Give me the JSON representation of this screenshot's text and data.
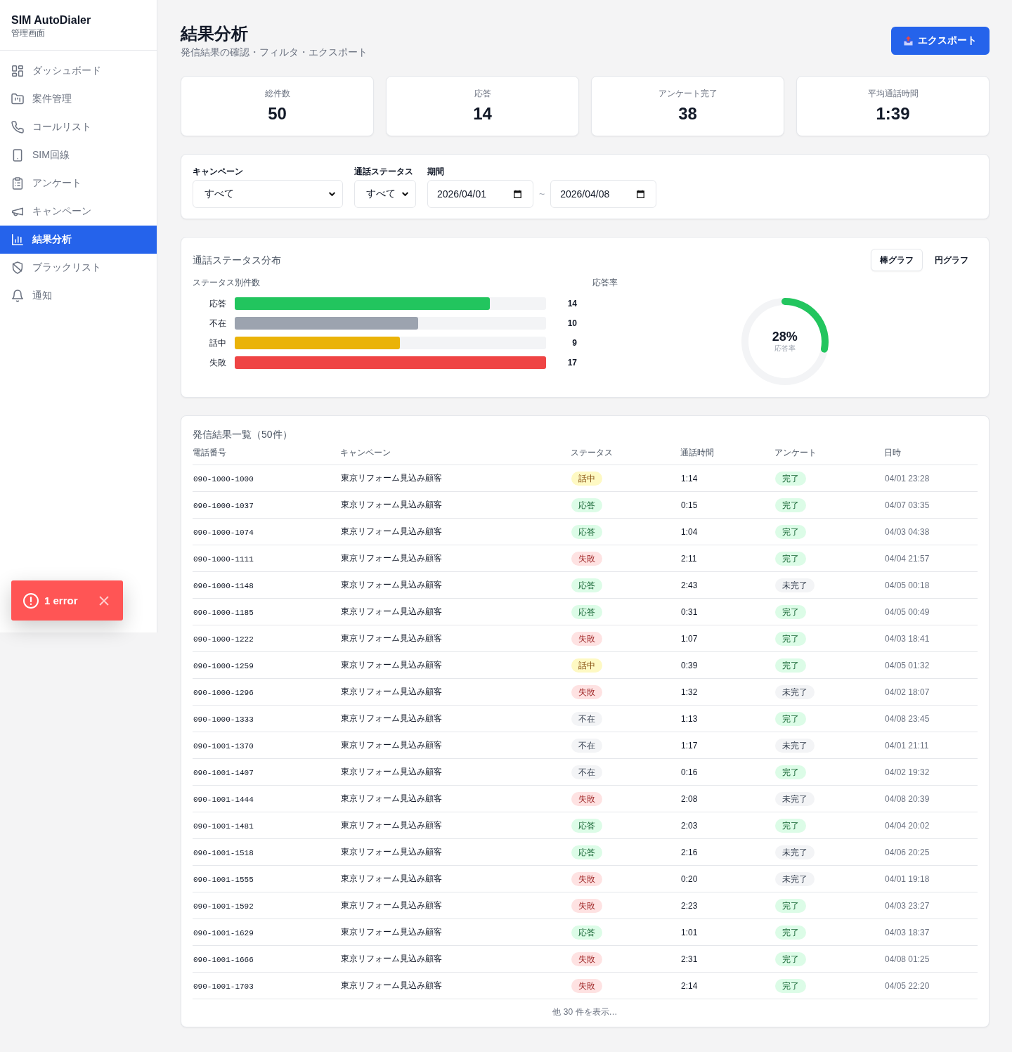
{
  "sidebar": {
    "brand": "SIM AutoDialer",
    "subtitle": "管理画面",
    "items": [
      {
        "label": "ダッシュボード",
        "selected": false
      },
      {
        "label": "案件管理",
        "selected": false
      },
      {
        "label": "コールリスト",
        "selected": false
      },
      {
        "label": "SIM回線",
        "selected": false
      },
      {
        "label": "アンケート",
        "selected": false
      },
      {
        "label": "キャンペーン",
        "selected": false
      },
      {
        "label": "結果分析",
        "selected": true
      },
      {
        "label": "ブラックリスト",
        "selected": false
      },
      {
        "label": "通知",
        "selected": false
      }
    ]
  },
  "header": {
    "title": "結果分析",
    "subtitle": "発信結果の確認・フィルタ・エクスポート",
    "export_button": "エクスポート"
  },
  "stats": [
    {
      "label": "総件数",
      "value": "50"
    },
    {
      "label": "応答",
      "value": "14"
    },
    {
      "label": "アンケート完了",
      "value": "38"
    },
    {
      "label": "平均通話時間",
      "value": "1:39"
    }
  ],
  "filters": {
    "campaign": {
      "label": "キャンペーン",
      "value": "すべて"
    },
    "status": {
      "label": "通話ステータス",
      "value": "すべて"
    },
    "period": {
      "label": "期間",
      "from": "2026/04/01",
      "separator": "~",
      "to": "2026/04/08"
    }
  },
  "status_chart": {
    "title": "通話ステータス分布",
    "view_tabs": [
      {
        "label": "棒グラフ",
        "selected": true
      },
      {
        "label": "円グラフ",
        "selected": false
      }
    ],
    "status_breakdown": {
      "title": "ステータス別件数",
      "bars": [
        {
          "label": "応答",
          "count": "14",
          "level": 0.82,
          "color": "#22c55e"
        },
        {
          "label": "不在",
          "count": "10",
          "level": 0.59,
          "color": "#9ca3af"
        },
        {
          "label": "話中",
          "count": "9",
          "level": 0.53,
          "color": "#eab308"
        },
        {
          "label": "失敗",
          "count": "17",
          "level": 1,
          "color": "#ef4444"
        }
      ]
    },
    "response_rate": {
      "label": "応答率",
      "value": "28%",
      "caption": "応答率"
    }
  },
  "results_table": {
    "title": "発信結果一覧（50件）",
    "columns": [
      "電話番号",
      "キャンペーン",
      "ステータス",
      "通話時間",
      "アンケート",
      "日時"
    ],
    "rows": [
      {
        "phone": "090-1000-1000",
        "campaign": "東京リフォーム見込み顧客",
        "status": {
          "label": "話中",
          "kind": "busy"
        },
        "duration": "1:14",
        "survey": {
          "label": "完了",
          "done": true
        },
        "datetime": "04/01 23:28"
      },
      {
        "phone": "090-1000-1037",
        "campaign": "東京リフォーム見込み顧客",
        "status": {
          "label": "応答",
          "kind": "answered"
        },
        "duration": "0:15",
        "survey": {
          "label": "完了",
          "done": true
        },
        "datetime": "04/07 03:35"
      },
      {
        "phone": "090-1000-1074",
        "campaign": "東京リフォーム見込み顧客",
        "status": {
          "label": "応答",
          "kind": "answered"
        },
        "duration": "1:04",
        "survey": {
          "label": "完了",
          "done": true
        },
        "datetime": "04/03 04:38"
      },
      {
        "phone": "090-1000-1111",
        "campaign": "東京リフォーム見込み顧客",
        "status": {
          "label": "失敗",
          "kind": "failed"
        },
        "duration": "2:11",
        "survey": {
          "label": "完了",
          "done": true
        },
        "datetime": "04/04 21:57"
      },
      {
        "phone": "090-1000-1148",
        "campaign": "東京リフォーム見込み顧客",
        "status": {
          "label": "応答",
          "kind": "answered"
        },
        "duration": "2:43",
        "survey": {
          "label": "未完了",
          "done": false
        },
        "datetime": "04/05 00:18"
      },
      {
        "phone": "090-1000-1185",
        "campaign": "東京リフォーム見込み顧客",
        "status": {
          "label": "応答",
          "kind": "answered"
        },
        "duration": "0:31",
        "survey": {
          "label": "完了",
          "done": true
        },
        "datetime": "04/05 00:49"
      },
      {
        "phone": "090-1000-1222",
        "campaign": "東京リフォーム見込み顧客",
        "status": {
          "label": "失敗",
          "kind": "failed"
        },
        "duration": "1:07",
        "survey": {
          "label": "完了",
          "done": true
        },
        "datetime": "04/03 18:41"
      },
      {
        "phone": "090-1000-1259",
        "campaign": "東京リフォーム見込み顧客",
        "status": {
          "label": "話中",
          "kind": "busy"
        },
        "duration": "0:39",
        "survey": {
          "label": "完了",
          "done": true
        },
        "datetime": "04/05 01:32"
      },
      {
        "phone": "090-1000-1296",
        "campaign": "東京リフォーム見込み顧客",
        "status": {
          "label": "失敗",
          "kind": "failed"
        },
        "duration": "1:32",
        "survey": {
          "label": "未完了",
          "done": false
        },
        "datetime": "04/02 18:07"
      },
      {
        "phone": "090-1000-1333",
        "campaign": "東京リフォーム見込み顧客",
        "status": {
          "label": "不在",
          "kind": "absent"
        },
        "duration": "1:13",
        "survey": {
          "label": "完了",
          "done": true
        },
        "datetime": "04/08 23:45"
      },
      {
        "phone": "090-1001-1370",
        "campaign": "東京リフォーム見込み顧客",
        "status": {
          "label": "不在",
          "kind": "absent"
        },
        "duration": "1:17",
        "survey": {
          "label": "未完了",
          "done": false
        },
        "datetime": "04/01 21:11"
      },
      {
        "phone": "090-1001-1407",
        "campaign": "東京リフォーム見込み顧客",
        "status": {
          "label": "不在",
          "kind": "absent"
        },
        "duration": "0:16",
        "survey": {
          "label": "完了",
          "done": true
        },
        "datetime": "04/02 19:32"
      },
      {
        "phone": "090-1001-1444",
        "campaign": "東京リフォーム見込み顧客",
        "status": {
          "label": "失敗",
          "kind": "failed"
        },
        "duration": "2:08",
        "survey": {
          "label": "未完了",
          "done": false
        },
        "datetime": "04/08 20:39"
      },
      {
        "phone": "090-1001-1481",
        "campaign": "東京リフォーム見込み顧客",
        "status": {
          "label": "応答",
          "kind": "answered"
        },
        "duration": "2:03",
        "survey": {
          "label": "完了",
          "done": true
        },
        "datetime": "04/04 20:02"
      },
      {
        "phone": "090-1001-1518",
        "campaign": "東京リフォーム見込み顧客",
        "status": {
          "label": "応答",
          "kind": "answered"
        },
        "duration": "2:16",
        "survey": {
          "label": "未完了",
          "done": false
        },
        "datetime": "04/06 20:25"
      },
      {
        "phone": "090-1001-1555",
        "campaign": "東京リフォーム見込み顧客",
        "status": {
          "label": "失敗",
          "kind": "failed"
        },
        "duration": "0:20",
        "survey": {
          "label": "未完了",
          "done": false
        },
        "datetime": "04/01 19:18"
      },
      {
        "phone": "090-1001-1592",
        "campaign": "東京リフォーム見込み顧客",
        "status": {
          "label": "失敗",
          "kind": "failed"
        },
        "duration": "2:23",
        "survey": {
          "label": "完了",
          "done": true
        },
        "datetime": "04/03 23:27"
      },
      {
        "phone": "090-1001-1629",
        "campaign": "東京リフォーム見込み顧客",
        "status": {
          "label": "応答",
          "kind": "answered"
        },
        "duration": "1:01",
        "survey": {
          "label": "完了",
          "done": true
        },
        "datetime": "04/03 18:37"
      },
      {
        "phone": "090-1001-1666",
        "campaign": "東京リフォーム見込み顧客",
        "status": {
          "label": "失敗",
          "kind": "failed"
        },
        "duration": "2:31",
        "survey": {
          "label": "完了",
          "done": true
        },
        "datetime": "04/08 01:25"
      },
      {
        "phone": "090-1001-1703",
        "campaign": "東京リフォーム見込み顧客",
        "status": {
          "label": "失敗",
          "kind": "failed"
        },
        "duration": "2:14",
        "survey": {
          "label": "完了",
          "done": true
        },
        "datetime": "04/05 22:20"
      }
    ],
    "more_link": "他 30 件を表示…"
  },
  "error_toast": {
    "message": "1 error"
  }
}
